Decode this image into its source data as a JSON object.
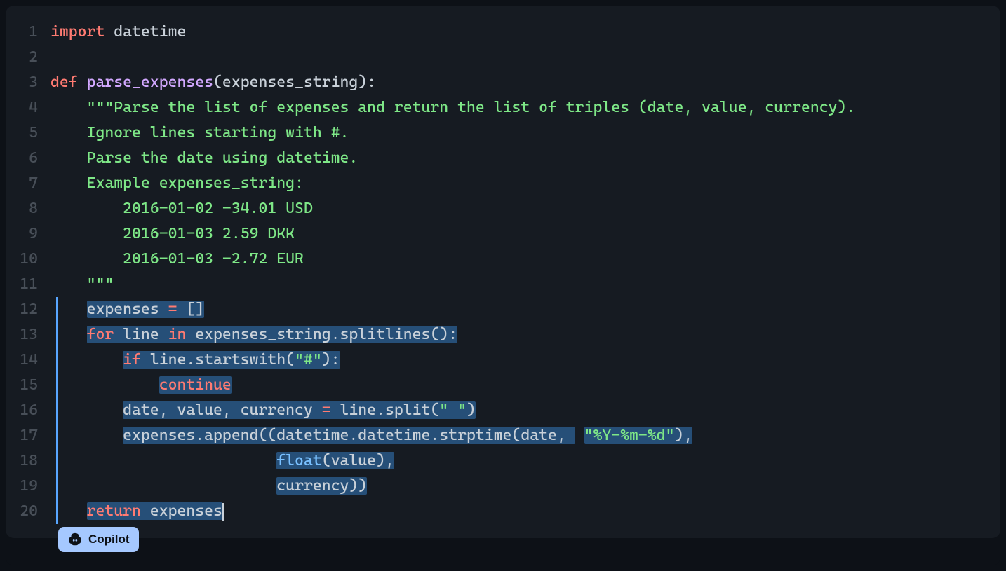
{
  "editor": {
    "badge_label": "Copilot",
    "lines": [
      {
        "num": 1,
        "highlighted": false
      },
      {
        "num": 2,
        "highlighted": false
      },
      {
        "num": 3,
        "highlighted": false
      },
      {
        "num": 4,
        "highlighted": false
      },
      {
        "num": 5,
        "highlighted": false
      },
      {
        "num": 6,
        "highlighted": false
      },
      {
        "num": 7,
        "highlighted": false
      },
      {
        "num": 8,
        "highlighted": false
      },
      {
        "num": 9,
        "highlighted": false
      },
      {
        "num": 10,
        "highlighted": false
      },
      {
        "num": 11,
        "highlighted": false
      },
      {
        "num": 12,
        "highlighted": true
      },
      {
        "num": 13,
        "highlighted": true
      },
      {
        "num": 14,
        "highlighted": true
      },
      {
        "num": 15,
        "highlighted": true
      },
      {
        "num": 16,
        "highlighted": true
      },
      {
        "num": 17,
        "highlighted": true
      },
      {
        "num": 18,
        "highlighted": true
      },
      {
        "num": 19,
        "highlighted": true
      },
      {
        "num": 20,
        "highlighted": true
      }
    ],
    "tokens": {
      "l1_import": "import",
      "l1_datetime": " datetime",
      "l2": "",
      "l3_def": "def",
      "l3_sp": " ",
      "l3_fn": "parse_expenses",
      "l3_p1": "(",
      "l3_arg": "expenses_string",
      "l3_p2": ")",
      "l3_colon": ":",
      "l4_indent": "    ",
      "l4_str": "\"\"\"Parse the list of expenses and return the list of triples (date, value, currency).",
      "l5_indent": "    ",
      "l5_str": "Ignore lines starting with #.",
      "l6_indent": "    ",
      "l6_str": "Parse the date using datetime.",
      "l7_indent": "    ",
      "l7_str": "Example expenses_string:",
      "l8_indent": "        ",
      "l8_str": "2016-01-02 -34.01 USD",
      "l9_indent": "        ",
      "l9_str": "2016-01-03 2.59 DKK",
      "l10_indent": "        ",
      "l10_str": "2016-01-03 -2.72 EUR",
      "l11_indent": "    ",
      "l11_str": "\"\"\"",
      "l12_indent": "    ",
      "l12_a": "expenses ",
      "l12_op": "=",
      "l12_b": " []",
      "l13_indent": "    ",
      "l13_for": "for",
      "l13_a": " line ",
      "l13_in": "in",
      "l13_b": " expenses_string.splitlines():",
      "l14_indent": "        ",
      "l14_if": "if",
      "l14_a": " line.startswith(",
      "l14_str": "\"#\"",
      "l14_b": "):",
      "l15_indent": "            ",
      "l15_continue": "continue",
      "l16_indent": "        ",
      "l16_a": "date, value, currency ",
      "l16_op": "=",
      "l16_b": " line.split(",
      "l16_str": "\" \"",
      "l16_c": ")",
      "l17_indent": "        ",
      "l17_a": "expenses.append((datetime.datetime.strptime(date, ",
      "l17_str": "\"%Y-%m-%d\"",
      "l17_b": "),",
      "l18_indent": "                         ",
      "l18_float": "float",
      "l18_a": "(value),",
      "l19_indent": "                         ",
      "l19_a": "currency))",
      "l20_indent": "    ",
      "l20_return": "return",
      "l20_a": " expenses"
    }
  }
}
